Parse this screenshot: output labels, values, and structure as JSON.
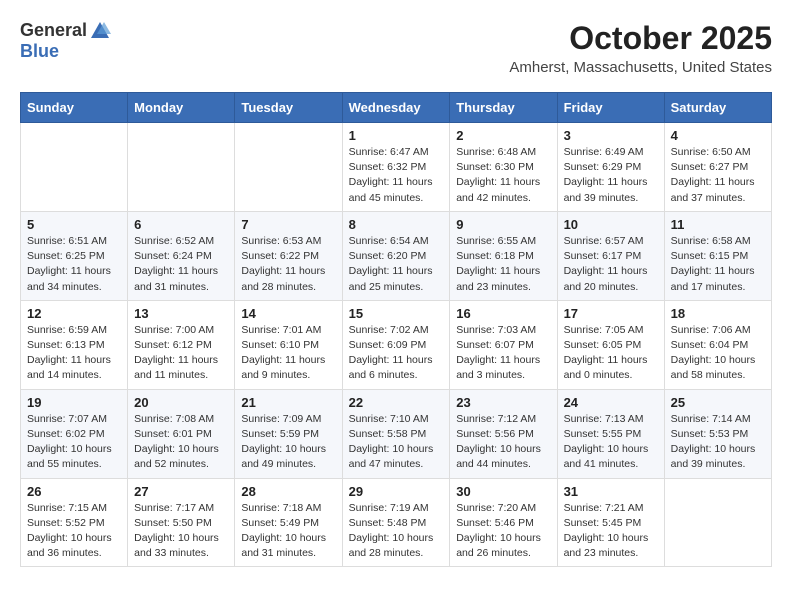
{
  "header": {
    "logo_general": "General",
    "logo_blue": "Blue",
    "month": "October 2025",
    "location": "Amherst, Massachusetts, United States"
  },
  "days_of_week": [
    "Sunday",
    "Monday",
    "Tuesday",
    "Wednesday",
    "Thursday",
    "Friday",
    "Saturday"
  ],
  "weeks": [
    [
      {
        "day": "",
        "info": ""
      },
      {
        "day": "",
        "info": ""
      },
      {
        "day": "",
        "info": ""
      },
      {
        "day": "1",
        "info": "Sunrise: 6:47 AM\nSunset: 6:32 PM\nDaylight: 11 hours\nand 45 minutes."
      },
      {
        "day": "2",
        "info": "Sunrise: 6:48 AM\nSunset: 6:30 PM\nDaylight: 11 hours\nand 42 minutes."
      },
      {
        "day": "3",
        "info": "Sunrise: 6:49 AM\nSunset: 6:29 PM\nDaylight: 11 hours\nand 39 minutes."
      },
      {
        "day": "4",
        "info": "Sunrise: 6:50 AM\nSunset: 6:27 PM\nDaylight: 11 hours\nand 37 minutes."
      }
    ],
    [
      {
        "day": "5",
        "info": "Sunrise: 6:51 AM\nSunset: 6:25 PM\nDaylight: 11 hours\nand 34 minutes."
      },
      {
        "day": "6",
        "info": "Sunrise: 6:52 AM\nSunset: 6:24 PM\nDaylight: 11 hours\nand 31 minutes."
      },
      {
        "day": "7",
        "info": "Sunrise: 6:53 AM\nSunset: 6:22 PM\nDaylight: 11 hours\nand 28 minutes."
      },
      {
        "day": "8",
        "info": "Sunrise: 6:54 AM\nSunset: 6:20 PM\nDaylight: 11 hours\nand 25 minutes."
      },
      {
        "day": "9",
        "info": "Sunrise: 6:55 AM\nSunset: 6:18 PM\nDaylight: 11 hours\nand 23 minutes."
      },
      {
        "day": "10",
        "info": "Sunrise: 6:57 AM\nSunset: 6:17 PM\nDaylight: 11 hours\nand 20 minutes."
      },
      {
        "day": "11",
        "info": "Sunrise: 6:58 AM\nSunset: 6:15 PM\nDaylight: 11 hours\nand 17 minutes."
      }
    ],
    [
      {
        "day": "12",
        "info": "Sunrise: 6:59 AM\nSunset: 6:13 PM\nDaylight: 11 hours\nand 14 minutes."
      },
      {
        "day": "13",
        "info": "Sunrise: 7:00 AM\nSunset: 6:12 PM\nDaylight: 11 hours\nand 11 minutes."
      },
      {
        "day": "14",
        "info": "Sunrise: 7:01 AM\nSunset: 6:10 PM\nDaylight: 11 hours\nand 9 minutes."
      },
      {
        "day": "15",
        "info": "Sunrise: 7:02 AM\nSunset: 6:09 PM\nDaylight: 11 hours\nand 6 minutes."
      },
      {
        "day": "16",
        "info": "Sunrise: 7:03 AM\nSunset: 6:07 PM\nDaylight: 11 hours\nand 3 minutes."
      },
      {
        "day": "17",
        "info": "Sunrise: 7:05 AM\nSunset: 6:05 PM\nDaylight: 11 hours\nand 0 minutes."
      },
      {
        "day": "18",
        "info": "Sunrise: 7:06 AM\nSunset: 6:04 PM\nDaylight: 10 hours\nand 58 minutes."
      }
    ],
    [
      {
        "day": "19",
        "info": "Sunrise: 7:07 AM\nSunset: 6:02 PM\nDaylight: 10 hours\nand 55 minutes."
      },
      {
        "day": "20",
        "info": "Sunrise: 7:08 AM\nSunset: 6:01 PM\nDaylight: 10 hours\nand 52 minutes."
      },
      {
        "day": "21",
        "info": "Sunrise: 7:09 AM\nSunset: 5:59 PM\nDaylight: 10 hours\nand 49 minutes."
      },
      {
        "day": "22",
        "info": "Sunrise: 7:10 AM\nSunset: 5:58 PM\nDaylight: 10 hours\nand 47 minutes."
      },
      {
        "day": "23",
        "info": "Sunrise: 7:12 AM\nSunset: 5:56 PM\nDaylight: 10 hours\nand 44 minutes."
      },
      {
        "day": "24",
        "info": "Sunrise: 7:13 AM\nSunset: 5:55 PM\nDaylight: 10 hours\nand 41 minutes."
      },
      {
        "day": "25",
        "info": "Sunrise: 7:14 AM\nSunset: 5:53 PM\nDaylight: 10 hours\nand 39 minutes."
      }
    ],
    [
      {
        "day": "26",
        "info": "Sunrise: 7:15 AM\nSunset: 5:52 PM\nDaylight: 10 hours\nand 36 minutes."
      },
      {
        "day": "27",
        "info": "Sunrise: 7:17 AM\nSunset: 5:50 PM\nDaylight: 10 hours\nand 33 minutes."
      },
      {
        "day": "28",
        "info": "Sunrise: 7:18 AM\nSunset: 5:49 PM\nDaylight: 10 hours\nand 31 minutes."
      },
      {
        "day": "29",
        "info": "Sunrise: 7:19 AM\nSunset: 5:48 PM\nDaylight: 10 hours\nand 28 minutes."
      },
      {
        "day": "30",
        "info": "Sunrise: 7:20 AM\nSunset: 5:46 PM\nDaylight: 10 hours\nand 26 minutes."
      },
      {
        "day": "31",
        "info": "Sunrise: 7:21 AM\nSunset: 5:45 PM\nDaylight: 10 hours\nand 23 minutes."
      },
      {
        "day": "",
        "info": ""
      }
    ]
  ]
}
